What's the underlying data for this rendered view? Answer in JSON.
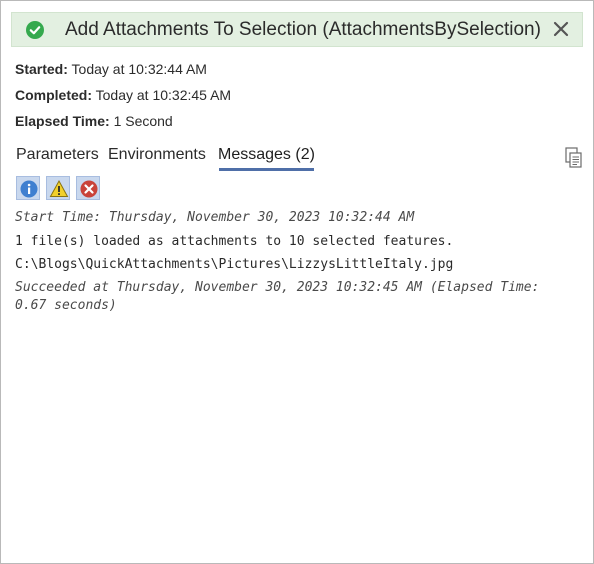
{
  "window": {
    "title": "Add Attachments To Selection (AttachmentsBySelection)",
    "status_icon": "check-circle-icon",
    "close_icon": "close-icon"
  },
  "summary": {
    "started_label": "Started:",
    "started_value": "Today at 10:32:44 AM",
    "completed_label": "Completed:",
    "completed_value": "Today at 10:32:45 AM",
    "elapsed_label": "Elapsed Time:",
    "elapsed_value": "1 Second"
  },
  "tabs": [
    {
      "label": "Parameters"
    },
    {
      "label": "Environments"
    },
    {
      "label": "Messages (2)"
    }
  ],
  "active_tab": "Messages (2)",
  "toolbar": {
    "copy_icon": "copy-icon",
    "filters": [
      "info-icon",
      "warning-icon",
      "error-icon"
    ]
  },
  "messages": [
    {
      "text": "Start Time: Thursday, November 30, 2023 10:32:44 AM",
      "style": "italic"
    },
    {
      "text": "1 file(s) loaded as attachments to 10 selected features.",
      "style": "normal"
    },
    {
      "text": "C:\\Blogs\\QuickAttachments\\Pictures\\LizzysLittleItaly.jpg",
      "style": "normal"
    },
    {
      "text": "Succeeded at Thursday, November 30, 2023 10:32:45 AM (Elapsed Time:",
      "style": "italic"
    },
    {
      "text": "0.67 seconds)",
      "style": "italic"
    }
  ],
  "colors": {
    "header_bg": "#e3f0e1",
    "success_green": "#35a94e",
    "tab_underline": "#4f6fa8"
  }
}
